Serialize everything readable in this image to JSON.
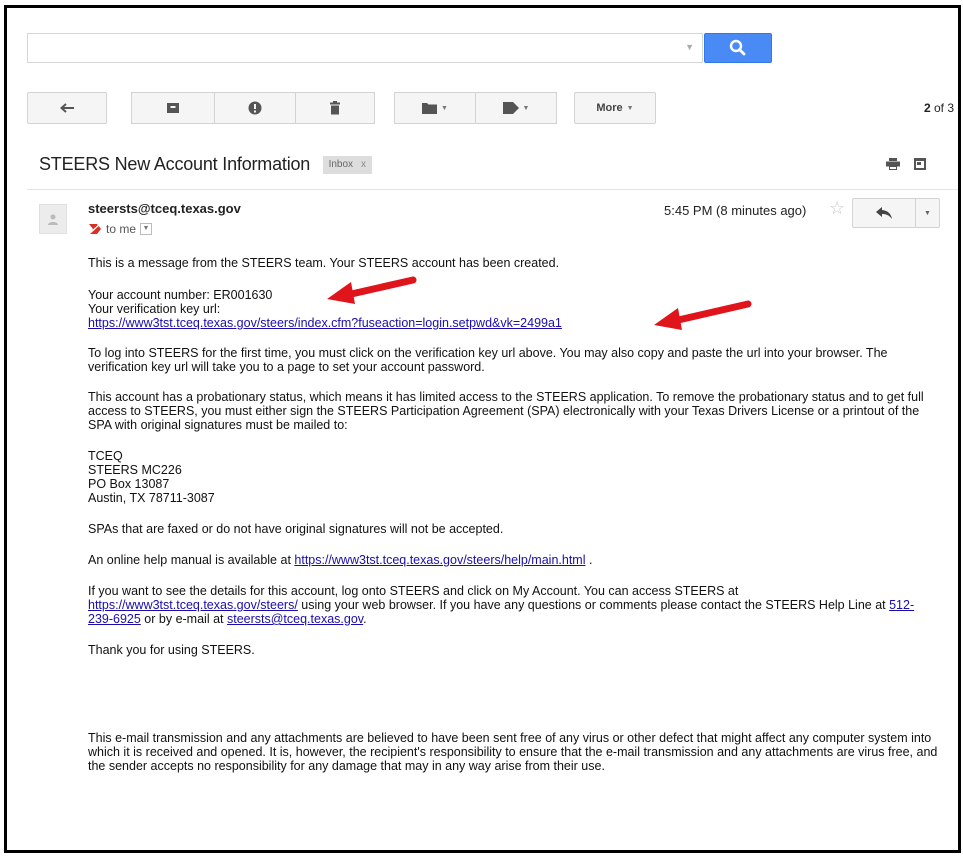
{
  "search": {
    "placeholder": ""
  },
  "toolbar": {
    "more_label": "More",
    "pager_current": "2",
    "pager_rest": " of 3"
  },
  "message": {
    "subject": "STEERS New Account Information",
    "label": "Inbox",
    "label_close": "x",
    "sender": "steersts@tceq.texas.gov",
    "recipient": "to me",
    "time": "5:45 PM (8 minutes ago)",
    "body": {
      "p1": "This is a message from the STEERS team.  Your STEERS account has been created.",
      "account_line": "Your account number: ER001630",
      "key_label": "Your verification key url:",
      "key_url": "https://www3tst.tceq.texas.gov/steers/index.cfm?fuseaction=login.setpwd&vk=2499a1",
      "p3": "To log into STEERS for the first time, you must click on the verification key url above. You may also copy and paste the url into your browser. The verification key url will take you to a page to set your account password.",
      "p4": "This account has a probationary status, which means it has limited access to the STEERS application. To remove the probationary status and to get full access to STEERS, you must either sign the STEERS Participation Agreement (SPA) electronically with your Texas Drivers License or a printout of the SPA with original signatures must be mailed to:",
      "addr1": "TCEQ",
      "addr2": "STEERS MC226",
      "addr3": "PO Box 13087",
      "addr4": "Austin, TX 78711-3087",
      "p6": "SPAs that are faxed or do not have original signatures will not be accepted.",
      "p7_pre": "An online help manual is available at ",
      "p7_link": "https://www3tst.tceq.texas.gov/steers/help/main.html",
      "p7_post": " .",
      "p8_a": "If you want to see the details for this account, log onto STEERS and click on My Account. You can access STEERS at ",
      "p8_link1": "https://www3tst.tceq.texas.gov/steers/",
      "p8_b": " using your web browser. If you have any questions or comments please contact the STEERS Help Line at ",
      "p8_phone": "512-239-6925",
      "p8_c": " or by e-mail at ",
      "p8_email": "steersts@tceq.texas.gov",
      "p8_d": ".",
      "p9": "Thank you for using STEERS.",
      "disclaimer": "This e-mail transmission and any attachments are believed to have been sent free of any virus or other defect that might affect any computer system into which it is received and opened. It is, however, the recipient's responsibility to ensure that the e-mail transmission and any attachments are virus free, and the sender accepts no responsibility for any damage that may in any way arise from their use."
    }
  },
  "colors": {
    "search_button": "#4a8af4",
    "link": "#1a0dab",
    "annotation_arrow": "#e0141b"
  }
}
